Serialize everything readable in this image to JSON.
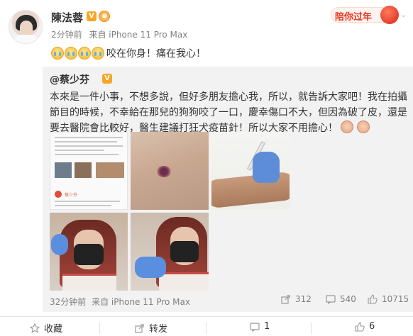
{
  "post": {
    "username": "陳法蓉",
    "time": "2分钟前",
    "source": "来自 iPhone 11 Pro Max",
    "text": "咬在你身！痛在我心！",
    "emoji_count": 4
  },
  "promo": {
    "label": "陪你过年"
  },
  "repost": {
    "user": "@蔡少芬",
    "body": "本來是一件小事，不想多說，但好多朋友擔心我，所以，就告訴大家吧！我在拍攝節目的時候，不幸給在那兒的狗狗咬了一口，慶幸傷口不大，但因為破了皮，還是要去醫院會比較好，醫生建議打狂犬疫苗針！所以大家不用擔心！",
    "picture_text": "蔡少芬",
    "time": "32分钟前",
    "source": "来自 iPhone 11 Pro Max",
    "reposts": "312",
    "comments": "540",
    "likes": "10715"
  },
  "actions": {
    "favorite": "收藏",
    "forward": "转发",
    "comment": "1",
    "like": "6"
  },
  "colors": {
    "accent": "#f6a623",
    "promo": "#e8341c",
    "meta": "#808080"
  }
}
